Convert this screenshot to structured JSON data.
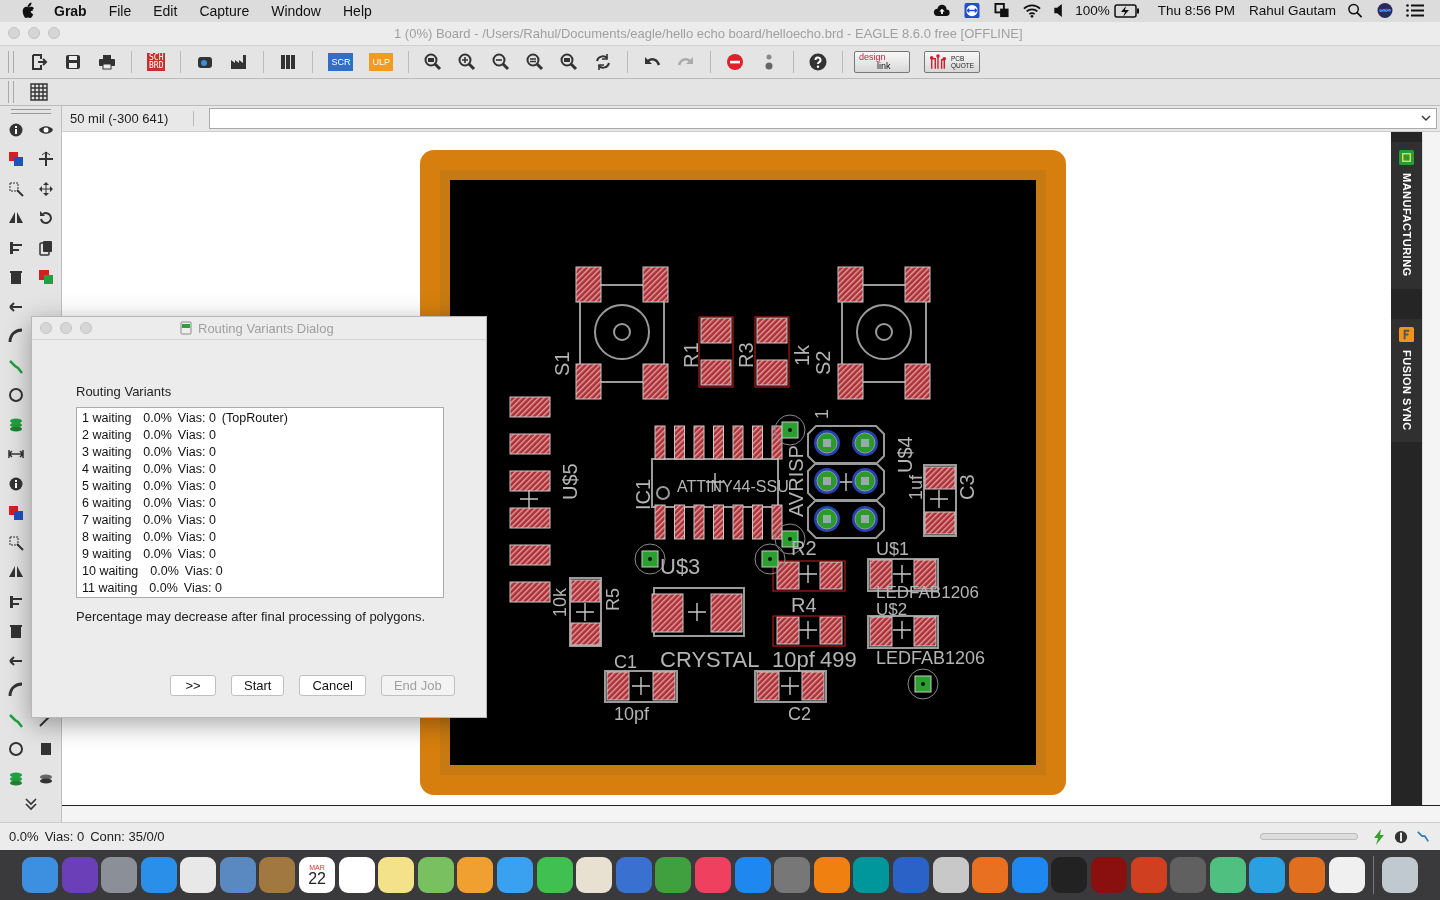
{
  "menu_bar": {
    "app": "Grab",
    "items": [
      "File",
      "Edit",
      "Capture",
      "Window",
      "Help"
    ],
    "battery": "100%",
    "clock": "Thu 8:56 PM",
    "user": "Rahul Gautam"
  },
  "window": {
    "title": "1 (0%) Board - /Users/Rahul/Documents/eagle/hello echo board/helloecho.brd - EAGLE 8.6.0 free [OFFLINE]"
  },
  "toolbar": {
    "sch_brd": [
      "SCH",
      "BRD"
    ],
    "script": "SCR",
    "ulp": "ULP",
    "design_link": [
      "design",
      "link"
    ],
    "pcb_quote": [
      "PCB",
      "QUOTE"
    ]
  },
  "command_bar": {
    "grid_readout": "50 mil (-300 641)"
  },
  "board": {
    "labels": [
      "S1",
      "R1",
      "R3",
      "1k",
      "S2",
      "U$5",
      "IC1",
      "ATTINY44-SSU",
      "1",
      "AVRISP",
      "U$4",
      "1uf",
      "C3",
      "R2",
      "U$3",
      "U$1",
      "R4",
      "LEDFAB1206",
      "U$2",
      "10k",
      "R5",
      "C1",
      "CRYSTAL",
      "10pf",
      "499",
      "LEDFAB1206",
      "10pf",
      "C2"
    ]
  },
  "side_tabs": [
    {
      "label": "MANUFACTURING"
    },
    {
      "label": "FUSION SYNC"
    }
  ],
  "dialog": {
    "title": "Routing Variants Dialog",
    "heading": "Routing Variants",
    "variants": [
      {
        "name": "1 waiting",
        "percent": "0.0%",
        "vias": "Vias: 0",
        "note": "(TopRouter)"
      },
      {
        "name": "2 waiting",
        "percent": "0.0%",
        "vias": "Vias: 0"
      },
      {
        "name": "3 waiting",
        "percent": "0.0%",
        "vias": "Vias: 0"
      },
      {
        "name": "4 waiting",
        "percent": "0.0%",
        "vias": "Vias: 0"
      },
      {
        "name": "5 waiting",
        "percent": "0.0%",
        "vias": "Vias: 0"
      },
      {
        "name": "6 waiting",
        "percent": "0.0%",
        "vias": "Vias: 0"
      },
      {
        "name": "7 waiting",
        "percent": "0.0%",
        "vias": "Vias: 0"
      },
      {
        "name": "8 waiting",
        "percent": "0.0%",
        "vias": "Vias: 0"
      },
      {
        "name": "9 waiting",
        "percent": "0.0%",
        "vias": "Vias: 0"
      },
      {
        "name": "10 waiting",
        "percent": "0.0%",
        "vias": "Vias: 0"
      },
      {
        "name": "11 waiting",
        "percent": "0.0%",
        "vias": "Vias: 0"
      }
    ],
    "note": "Percentage may decrease after final processing of polygons.",
    "buttons": [
      {
        "label": ">>",
        "disabled": false
      },
      {
        "label": "Start",
        "disabled": false
      },
      {
        "label": "Cancel",
        "disabled": false
      },
      {
        "label": "End Job",
        "disabled": true
      }
    ]
  },
  "status_bar": {
    "items": [
      "0.0%",
      "Vias: 0",
      "Conn: 35/0/0"
    ],
    "progress": {
      "level": 0
    }
  },
  "dock": {
    "calendar": {
      "month": "MAR",
      "day": "22"
    }
  }
}
